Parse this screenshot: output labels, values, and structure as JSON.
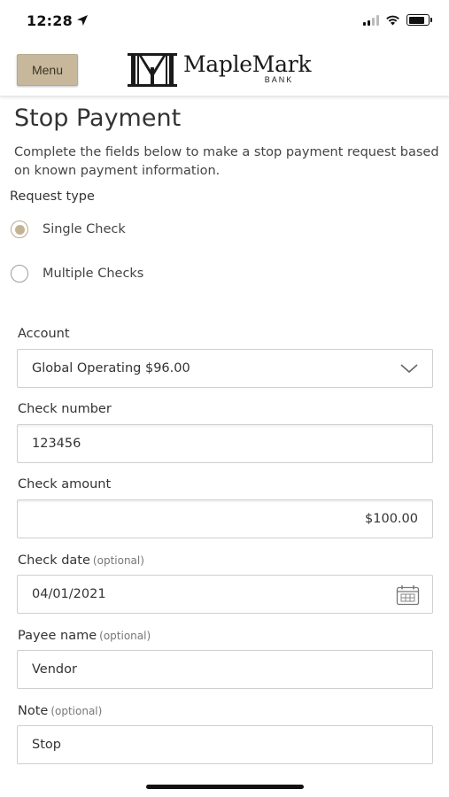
{
  "status": {
    "time": "12:28"
  },
  "header": {
    "menu_label": "Menu",
    "logo_name": "MapleMark",
    "logo_sub": "BANK"
  },
  "page": {
    "title": "Stop Payment",
    "description": "Complete the fields below to make a stop payment request based on known payment information."
  },
  "request_type": {
    "label": "Request type",
    "options": [
      {
        "label": "Single Check",
        "selected": true
      },
      {
        "label": "Multiple Checks",
        "selected": false
      }
    ]
  },
  "form": {
    "account": {
      "label": "Account",
      "value": "Global Operating  $96.00"
    },
    "check_number": {
      "label": "Check number",
      "value": "123456"
    },
    "check_amount": {
      "label": "Check amount",
      "value": "$100.00"
    },
    "check_date": {
      "label": "Check date",
      "optional": "(optional)",
      "value": "04/01/2021"
    },
    "payee_name": {
      "label": "Payee name",
      "optional": "(optional)",
      "value": "Vendor"
    },
    "note": {
      "label": "Note",
      "optional": "(optional)",
      "value": "Stop"
    }
  },
  "colors": {
    "accent": "#c7b89c",
    "radio_fill": "#c2b393"
  },
  "icons": [
    "location-arrow-icon",
    "cellular-signal-icon",
    "wifi-icon",
    "battery-icon",
    "chevron-down-icon",
    "calendar-icon"
  ]
}
